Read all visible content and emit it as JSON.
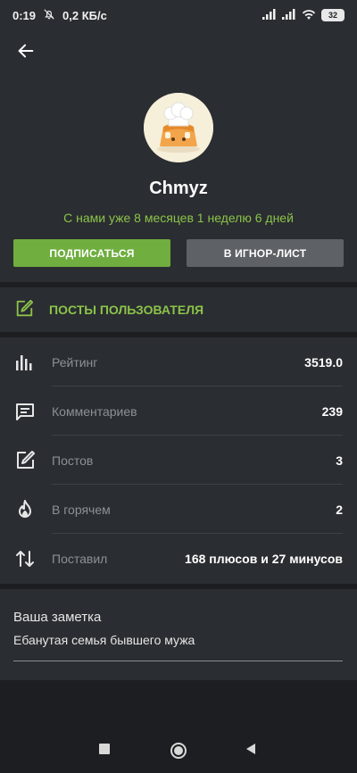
{
  "status_bar": {
    "time": "0:19",
    "speed": "0,2 КБ/с",
    "battery": "32"
  },
  "profile": {
    "username": "Chmyz",
    "member_since": "С нами уже 8 месяцев 1 неделю 6 дней",
    "subscribe_label": "ПОДПИСАТЬСЯ",
    "ignore_label": "В ИГНОР-ЛИСТ"
  },
  "posts_link": {
    "label": "ПОСТЫ ПОЛЬЗОВАТЕЛЯ"
  },
  "stats": [
    {
      "label": "Рейтинг",
      "value": "3519.0",
      "icon": "bar-chart-icon"
    },
    {
      "label": "Комментариев",
      "value": "239",
      "icon": "comment-icon"
    },
    {
      "label": "Постов",
      "value": "3",
      "icon": "edit-icon"
    },
    {
      "label": "В горячем",
      "value": "2",
      "icon": "fire-icon"
    },
    {
      "label": "Поставил",
      "value": "168 плюсов и 27 минусов",
      "icon": "swap-vertical-icon"
    }
  ],
  "note": {
    "title": "Ваша заметка",
    "text": "Ебанутая семья бывшего мужа"
  },
  "colors": {
    "accent": "#8bc34a",
    "button_green": "#6fae3f",
    "button_gray": "#5e6165",
    "panel": "#2a2d31",
    "background": "#1c1e21"
  }
}
